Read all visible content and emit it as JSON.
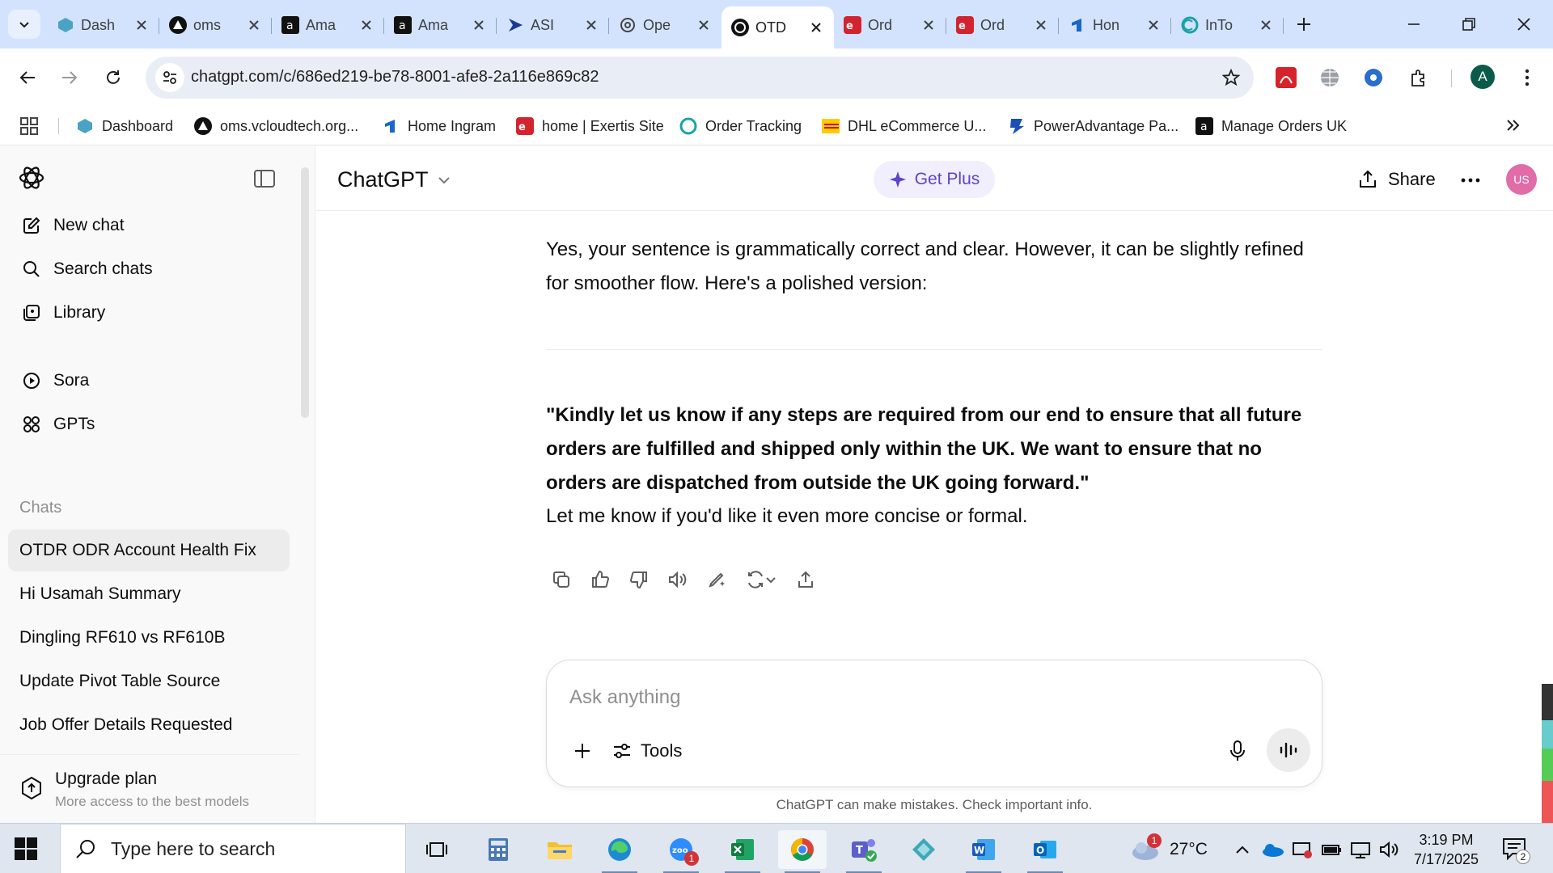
{
  "browser": {
    "tabs": [
      {
        "title": "Dash",
        "icon": "dashboard-icon"
      },
      {
        "title": "oms",
        "icon": "triangle-logo-icon"
      },
      {
        "title": "Ama",
        "icon": "amazon-icon"
      },
      {
        "title": "Ama",
        "icon": "amazon-icon"
      },
      {
        "title": "ASI",
        "icon": "asi-arrow-icon"
      },
      {
        "title": "Ope",
        "icon": "openai-icon"
      },
      {
        "title": "OTD",
        "icon": "openai-icon"
      },
      {
        "title": "Ord",
        "icon": "exertis-icon"
      },
      {
        "title": "Ord",
        "icon": "exertis-icon"
      },
      {
        "title": "Hon",
        "icon": "ingram-icon"
      },
      {
        "title": "InTo",
        "icon": "intouch-icon"
      }
    ],
    "url": "chatgpt.com/c/686ed219-be78-8001-afe8-2a116e869c82",
    "profile_initial": "A",
    "bookmarks": [
      {
        "label": "Dashboard",
        "icon": "dashboard-icon"
      },
      {
        "label": "oms.vcloudtech.org...",
        "icon": "triangle-logo-icon"
      },
      {
        "label": "Home Ingram",
        "icon": "ingram-icon"
      },
      {
        "label": "home | Exertis Site",
        "icon": "exertis-icon"
      },
      {
        "label": "Order Tracking",
        "icon": "intouch-icon"
      },
      {
        "label": "DHL eCommerce U...",
        "icon": "dhl-icon"
      },
      {
        "label": "PowerAdvantage Pa...",
        "icon": "poweradvantage-icon"
      },
      {
        "label": "Manage Orders UK",
        "icon": "amazon-icon"
      }
    ]
  },
  "sidebar": {
    "nav": [
      {
        "label": "New chat",
        "icon": "new-chat-icon"
      },
      {
        "label": "Search chats",
        "icon": "search-icon"
      },
      {
        "label": "Library",
        "icon": "library-icon"
      },
      {
        "label": "Sora",
        "icon": "play-circle-icon"
      },
      {
        "label": "GPTs",
        "icon": "gpts-grid-icon"
      }
    ],
    "chats_heading": "Chats",
    "chats": [
      "OTDR ODR Account Health Fix",
      "Hi Usamah Summary",
      "Dingling RF610 vs RF610B",
      "Update Pivot Table Source",
      "Job Offer Details Requested"
    ],
    "upgrade": {
      "title": "Upgrade plan",
      "subtitle": "More access to the best models"
    }
  },
  "header": {
    "model": "ChatGPT",
    "get_plus": "Get Plus",
    "share": "Share",
    "user_initials": "US"
  },
  "conversation": {
    "intro": "Yes, your sentence is grammatically correct and clear. However, it can be slightly refined for smoother flow. Here's a polished version:",
    "quote": "\"Kindly let us know if any steps are required from our end to ensure that all future orders are fulfilled and shipped only within the UK. We want to ensure that no orders are dispatched from outside the UK going forward.\"",
    "followup": "Let me know if you'd like it even more concise or formal."
  },
  "composer": {
    "placeholder": "Ask anything",
    "tools_label": "Tools",
    "disclaimer": "ChatGPT can make mistakes. Check important info."
  },
  "taskbar": {
    "search_placeholder": "Type here to search",
    "zoom_badge": "1",
    "weather": {
      "temp": "27°C",
      "alert": "1"
    },
    "time": "3:19 PM",
    "date": "7/17/2025",
    "notifications": "2"
  },
  "colors": {
    "tab_strip": "#d3e3fd",
    "get_plus_bg": "#f1effd",
    "get_plus_fg": "#5b45c9",
    "avatar_bg": "#e06ca8",
    "sidebar_bg": "#f9f9f9"
  }
}
